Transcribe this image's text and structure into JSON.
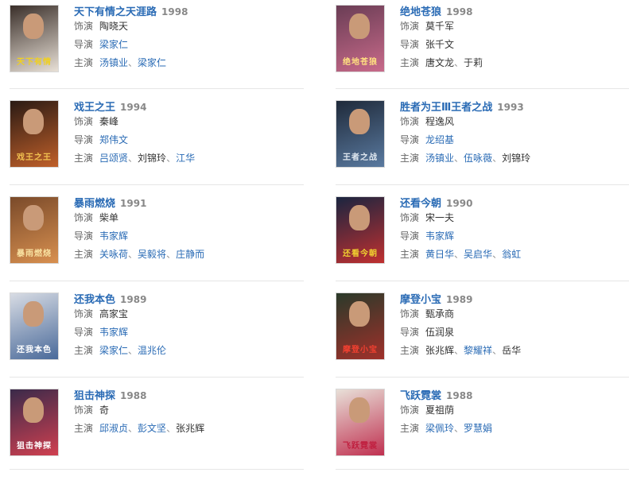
{
  "items": [
    {
      "title": "天下有情之天涯路",
      "year": "1998",
      "poster": {
        "bg": "#3a2f2a",
        "accent": "#e8e0d6",
        "text": "天下有情",
        "textColor": "#f0d020"
      },
      "role_label": "饰演",
      "role": "陶晓天",
      "director_label": "导演",
      "director": [
        {
          "name": "梁家仁",
          "link": true
        }
      ],
      "cast_label": "主演",
      "cast": [
        {
          "name": "汤镇业",
          "link": true
        },
        {
          "name": "梁家仁",
          "link": true
        }
      ]
    },
    {
      "title": "绝地苍狼",
      "year": "1998",
      "poster": {
        "bg": "#6a3d55",
        "accent": "#c86a8a",
        "text": "绝地苍狼",
        "textColor": "#ffe080"
      },
      "role_label": "饰演",
      "role": "莫千军",
      "director_label": "导演",
      "director": [
        {
          "name": "张千文",
          "link": false
        }
      ],
      "cast_label": "主演",
      "cast": [
        {
          "name": "唐文龙",
          "link": false
        },
        {
          "name": "于莉",
          "link": false
        }
      ]
    },
    {
      "title": "戏王之王",
      "year": "1994",
      "poster": {
        "bg": "#2a1a14",
        "accent": "#c0602a",
        "text": "戏王之王",
        "textColor": "#f0c050"
      },
      "role_label": "饰演",
      "role": "秦峰",
      "director_label": "导演",
      "director": [
        {
          "name": "郑伟文",
          "link": true
        }
      ],
      "cast_label": "主演",
      "cast": [
        {
          "name": "吕颂贤",
          "link": true
        },
        {
          "name": "刘锦玲",
          "link": false
        },
        {
          "name": "江华",
          "link": true
        }
      ]
    },
    {
      "title": "胜者为王Ⅲ王者之战",
      "year": "1993",
      "poster": {
        "bg": "#1f2a3a",
        "accent": "#5a7aa0",
        "text": "王者之战",
        "textColor": "#e0e8f0"
      },
      "role_label": "饰演",
      "role": "程逸风",
      "director_label": "导演",
      "director": [
        {
          "name": "龙绍基",
          "link": true
        }
      ],
      "cast_label": "主演",
      "cast": [
        {
          "name": "汤镇业",
          "link": true
        },
        {
          "name": "伍咏薇",
          "link": true
        },
        {
          "name": "刘锦玲",
          "link": false
        }
      ]
    },
    {
      "title": "暴雨燃烧",
      "year": "1991",
      "poster": {
        "bg": "#7a4a2a",
        "accent": "#d89050",
        "text": "暴雨燃烧",
        "textColor": "#f8e0a0"
      },
      "role_label": "饰演",
      "role": "柴单",
      "director_label": "导演",
      "director": [
        {
          "name": "韦家辉",
          "link": true
        }
      ],
      "cast_label": "主演",
      "cast": [
        {
          "name": "关咏荷",
          "link": true
        },
        {
          "name": "吴毅将",
          "link": true
        },
        {
          "name": "庄静而",
          "link": true
        }
      ]
    },
    {
      "title": "还看今朝",
      "year": "1990",
      "poster": {
        "bg": "#1a2540",
        "accent": "#c03030",
        "text": "还看今朝",
        "textColor": "#f0d030"
      },
      "role_label": "饰演",
      "role": "宋一夫",
      "director_label": "导演",
      "director": [
        {
          "name": "韦家辉",
          "link": true
        }
      ],
      "cast_label": "主演",
      "cast": [
        {
          "name": "黄日华",
          "link": true
        },
        {
          "name": "吴启华",
          "link": true
        },
        {
          "name": "翁虹",
          "link": true
        }
      ]
    },
    {
      "title": "还我本色",
      "year": "1989",
      "poster": {
        "bg": "#d8dce4",
        "accent": "#4a6a9a",
        "text": "还我本色",
        "textColor": "#ffffff"
      },
      "role_label": "饰演",
      "role": "高家宝",
      "director_label": "导演",
      "director": [
        {
          "name": "韦家辉",
          "link": true
        }
      ],
      "cast_label": "主演",
      "cast": [
        {
          "name": "梁家仁",
          "link": true
        },
        {
          "name": "温兆伦",
          "link": true
        }
      ]
    },
    {
      "title": "摩登小宝",
      "year": "1989",
      "poster": {
        "bg": "#2a3a2a",
        "accent": "#a0302a",
        "text": "摩登小宝",
        "textColor": "#f04030"
      },
      "role_label": "饰演",
      "role": "甄承商",
      "director_label": "导演",
      "director": [
        {
          "name": "伍润泉",
          "link": false
        }
      ],
      "cast_label": "主演",
      "cast": [
        {
          "name": "张兆辉",
          "link": false
        },
        {
          "name": "黎耀祥",
          "link": true
        },
        {
          "name": "岳华",
          "link": false
        }
      ]
    },
    {
      "title": "狙击神探",
      "year": "1988",
      "poster": {
        "bg": "#3a2a4a",
        "accent": "#d04050",
        "text": "狙击神探",
        "textColor": "#ffffff"
      },
      "role_label": "饰演",
      "role": "奇",
      "cast_label": "主演",
      "cast": [
        {
          "name": "邱淑贞",
          "link": true
        },
        {
          "name": "彭文坚",
          "link": true
        },
        {
          "name": "张兆辉",
          "link": false
        }
      ]
    },
    {
      "title": "飞跃霓裳",
      "year": "1988",
      "poster": {
        "bg": "#e8e0d8",
        "accent": "#c03050",
        "text": "飞跃霓裳",
        "textColor": "#c02040"
      },
      "role_label": "饰演",
      "role": "夏祖荫",
      "cast_label": "主演",
      "cast": [
        {
          "name": "梁佩玲",
          "link": true
        },
        {
          "name": "罗慧娟",
          "link": true
        }
      ]
    }
  ]
}
